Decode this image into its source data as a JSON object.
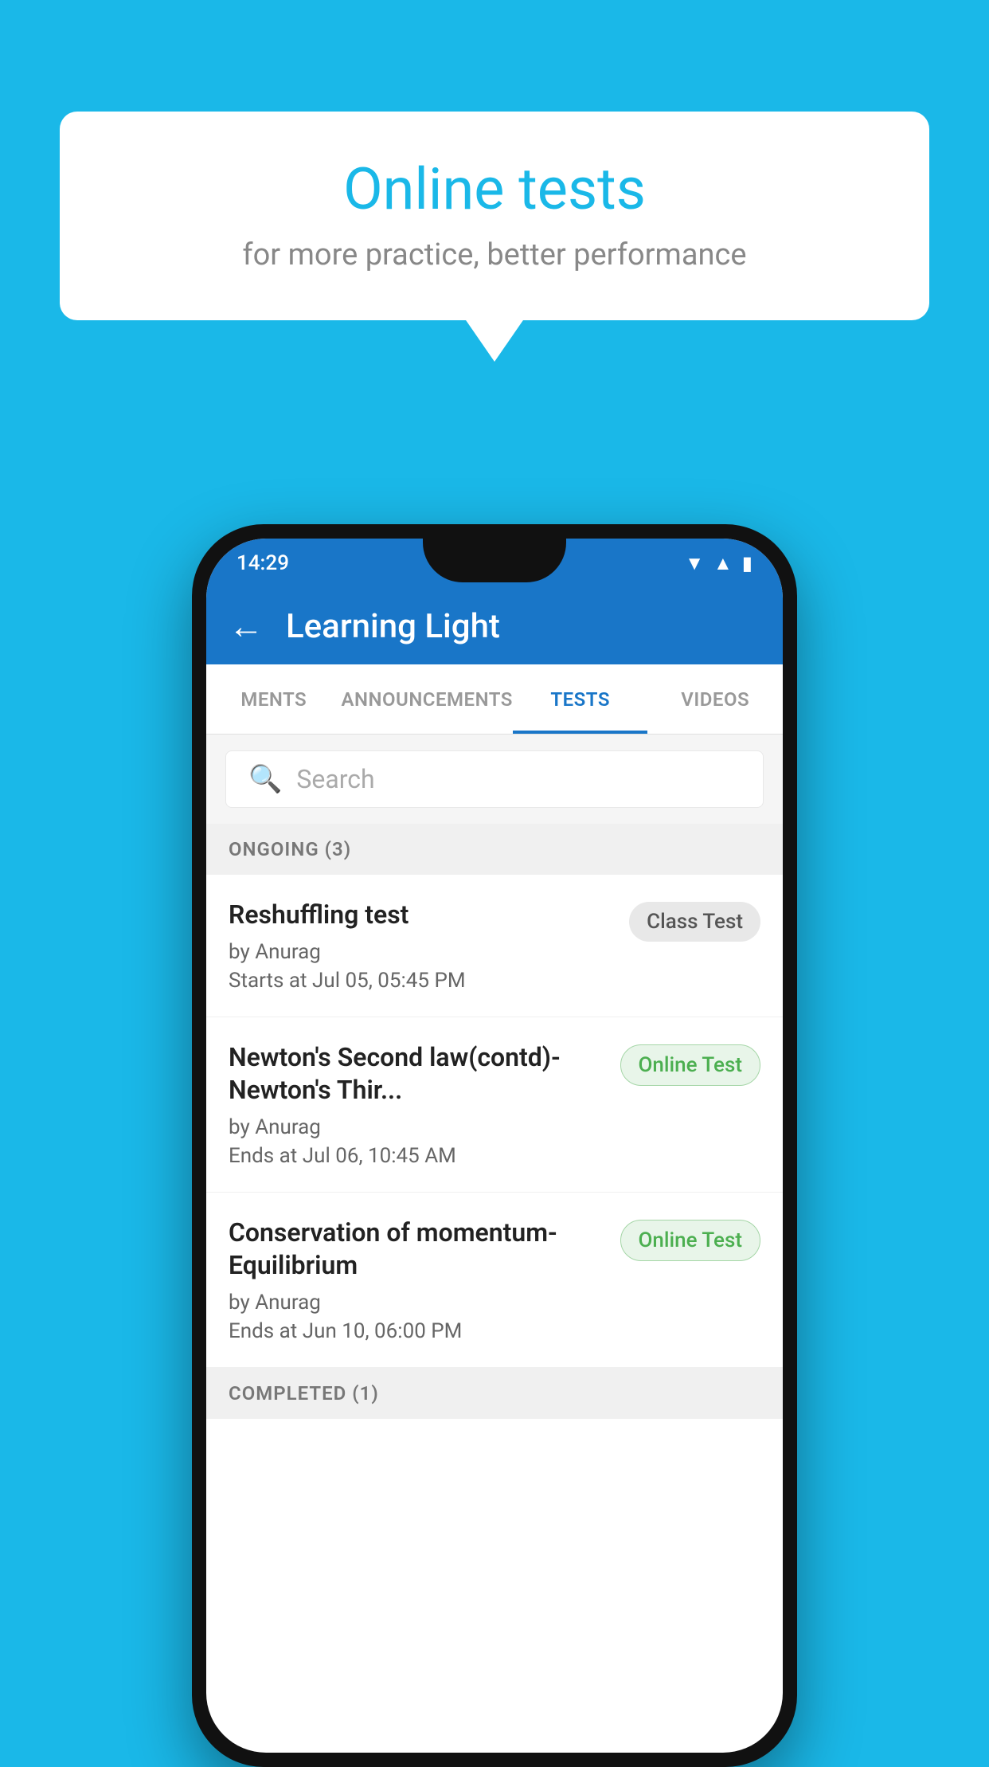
{
  "background": {
    "color": "#1ab8e8"
  },
  "speech_bubble": {
    "title": "Online tests",
    "subtitle": "for more practice, better performance"
  },
  "phone": {
    "status_bar": {
      "time": "14:29",
      "icons": [
        "wifi",
        "signal",
        "battery"
      ]
    },
    "app_bar": {
      "back_label": "←",
      "title": "Learning Light"
    },
    "tabs": [
      {
        "label": "MENTS",
        "active": false
      },
      {
        "label": "ANNOUNCEMENTS",
        "active": false
      },
      {
        "label": "TESTS",
        "active": true
      },
      {
        "label": "VIDEOS",
        "active": false
      }
    ],
    "search": {
      "placeholder": "Search"
    },
    "sections": [
      {
        "header": "ONGOING (3)",
        "items": [
          {
            "title": "Reshuffling test",
            "author": "by Anurag",
            "time_label": "Starts at",
            "time": "Jul 05, 05:45 PM",
            "badge": "Class Test",
            "badge_type": "class"
          },
          {
            "title": "Newton's Second law(contd)-Newton's Thir...",
            "author": "by Anurag",
            "time_label": "Ends at",
            "time": "Jul 06, 10:45 AM",
            "badge": "Online Test",
            "badge_type": "online"
          },
          {
            "title": "Conservation of momentum-Equilibrium",
            "author": "by Anurag",
            "time_label": "Ends at",
            "time": "Jun 10, 06:00 PM",
            "badge": "Online Test",
            "badge_type": "online"
          }
        ]
      },
      {
        "header": "COMPLETED (1)",
        "items": []
      }
    ]
  }
}
